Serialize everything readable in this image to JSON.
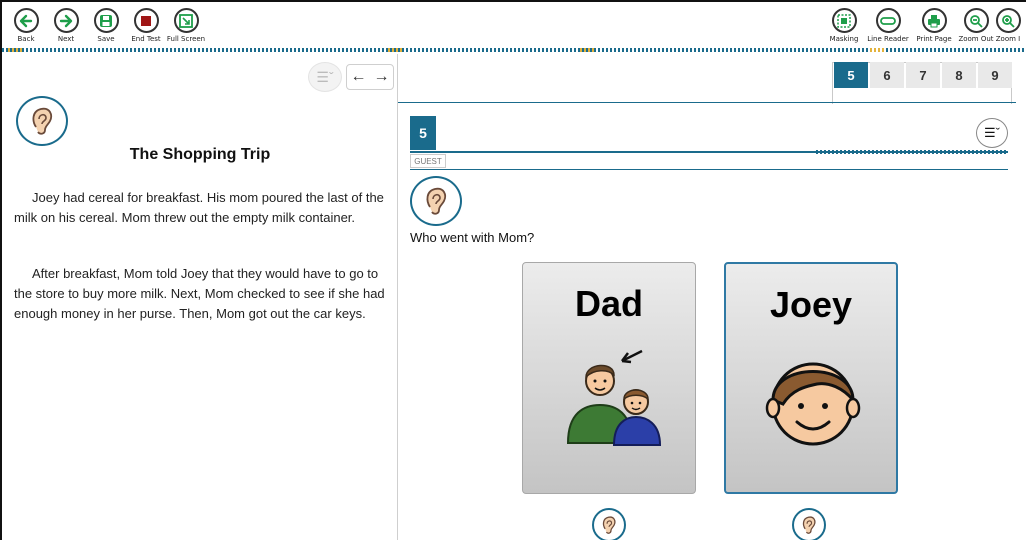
{
  "toolbar": {
    "left": [
      {
        "label": "Back",
        "icon": "arrow-left-icon",
        "color": "#1e9e4a"
      },
      {
        "label": "Next",
        "icon": "arrow-right-icon",
        "color": "#1e9e4a"
      },
      {
        "label": "Save",
        "icon": "save-icon",
        "color": "#1e9e4a"
      },
      {
        "label": "End Test",
        "icon": "stop-icon",
        "color": "#a01616"
      },
      {
        "label": "Full Screen",
        "icon": "full-screen-icon",
        "color": "#1e9e4a"
      }
    ],
    "right": [
      {
        "label": "Masking",
        "icon": "masking-icon",
        "color": "#1e9e4a"
      },
      {
        "label": "Line Reader",
        "icon": "line-reader-icon",
        "color": "#1e9e4a"
      },
      {
        "label": "Print Page",
        "icon": "printer-icon",
        "color": "#1e9e4a"
      },
      {
        "label": "Zoom Out",
        "icon": "zoom-out-icon",
        "color": "#1e9e4a"
      },
      {
        "label": "Zoom I",
        "icon": "zoom-in-icon",
        "color": "#1e9e4a"
      }
    ]
  },
  "passage": {
    "title": "The Shopping Trip",
    "paragraphs": [
      "Joey had cereal for breakfast. His mom poured the last of the milk on his cereal. Mom threw out the empty milk container.",
      "After breakfast, Mom told Joey that they would have to go to the store to buy more milk. Next, Mom checked to see if she had enough money in her purse. Then, Mom got out the car keys."
    ]
  },
  "question_tabs": [
    "5",
    "6",
    "7",
    "8",
    "9"
  ],
  "active_tab": "5",
  "question": {
    "number": "5",
    "guest_label": "GUEST",
    "text": "Who went with Mom?",
    "choices": [
      {
        "word": "Dad",
        "selected": false
      },
      {
        "word": "Joey",
        "selected": true
      }
    ]
  },
  "colors": {
    "accent": "#1a6b8c",
    "toolbar_green": "#1e9e4a",
    "end_test_red": "#a01616",
    "selected_border": "#2f79a4"
  }
}
